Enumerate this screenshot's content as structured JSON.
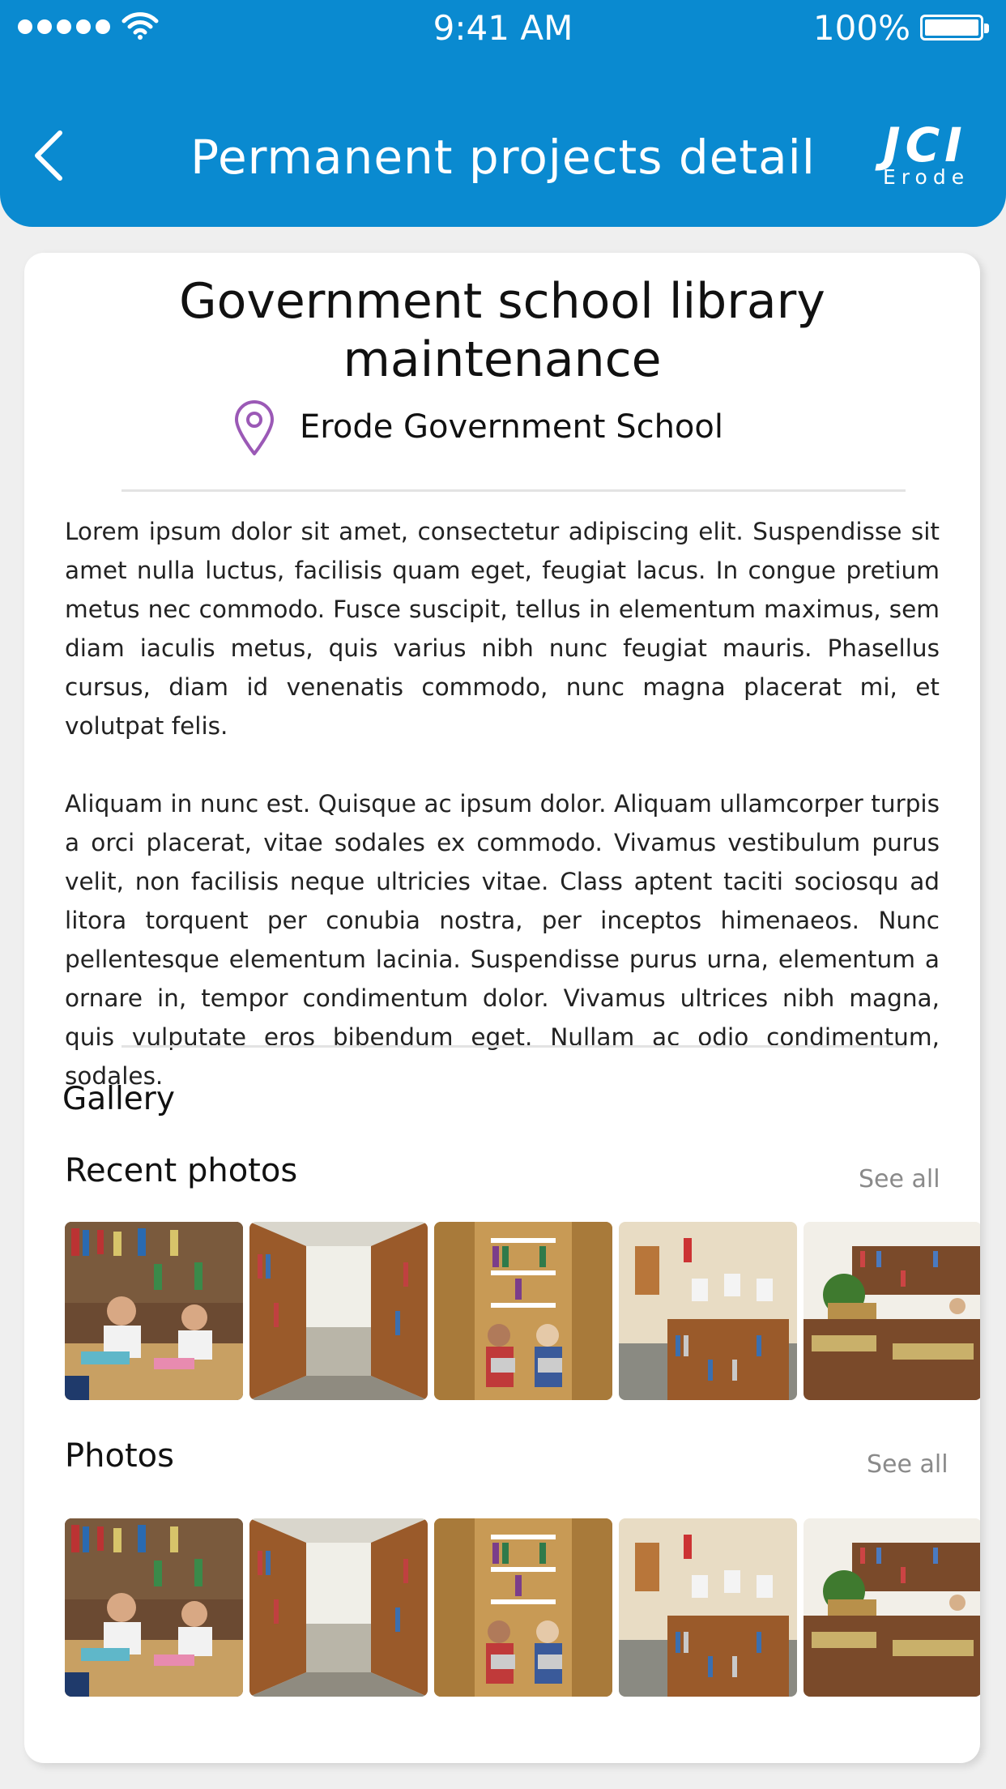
{
  "status_bar": {
    "time": "9:41 AM",
    "battery": "100%"
  },
  "header": {
    "title": "Permanent projects detail",
    "logo_main": "JCI",
    "logo_sub": "Erode"
  },
  "project": {
    "title": "Government school library maintenance",
    "location": "Erode Government School",
    "description": [
      "Lorem ipsum dolor sit amet, consectetur adipiscing elit. Suspendisse sit amet nulla luctus, facilisis quam eget, feugiat lacus. In congue pretium metus nec commodo. Fusce suscipit, tellus in elementum maximus, sem diam iaculis metus, quis varius nibh nunc feugiat mauris. Phasellus cursus, diam id venenatis commodo, nunc magna placerat mi, et volutpat felis.",
      "Aliquam in nunc est. Quisque ac ipsum dolor. Aliquam ullamcorper turpis a orci placerat, vitae sodales ex commodo. Vivamus vestibulum purus velit, non facilisis neque ultricies vitae. Class aptent taciti sociosqu ad litora torquent per conubia nostra, per inceptos himenaeos. Nunc pellentesque elementum lacinia. Suspendisse purus urna, elementum a ornare in, tempor condimentum dolor. Vivamus ultrices nibh magna, quis vulputate eros bibendum eget. Nullam ac odio condimentum, sodales."
    ]
  },
  "gallery": {
    "label": "Gallery",
    "recent": {
      "label": "Recent photos",
      "see_all": "See all"
    },
    "photos": {
      "label": "Photos",
      "see_all": "See all"
    }
  },
  "colors": {
    "header": "#0a8ad0",
    "pin": "#9b59b6",
    "muted": "#8a8a8a"
  },
  "icons": [
    "back-chevron-icon",
    "location-pin-icon",
    "wifi-icon",
    "battery-icon"
  ]
}
